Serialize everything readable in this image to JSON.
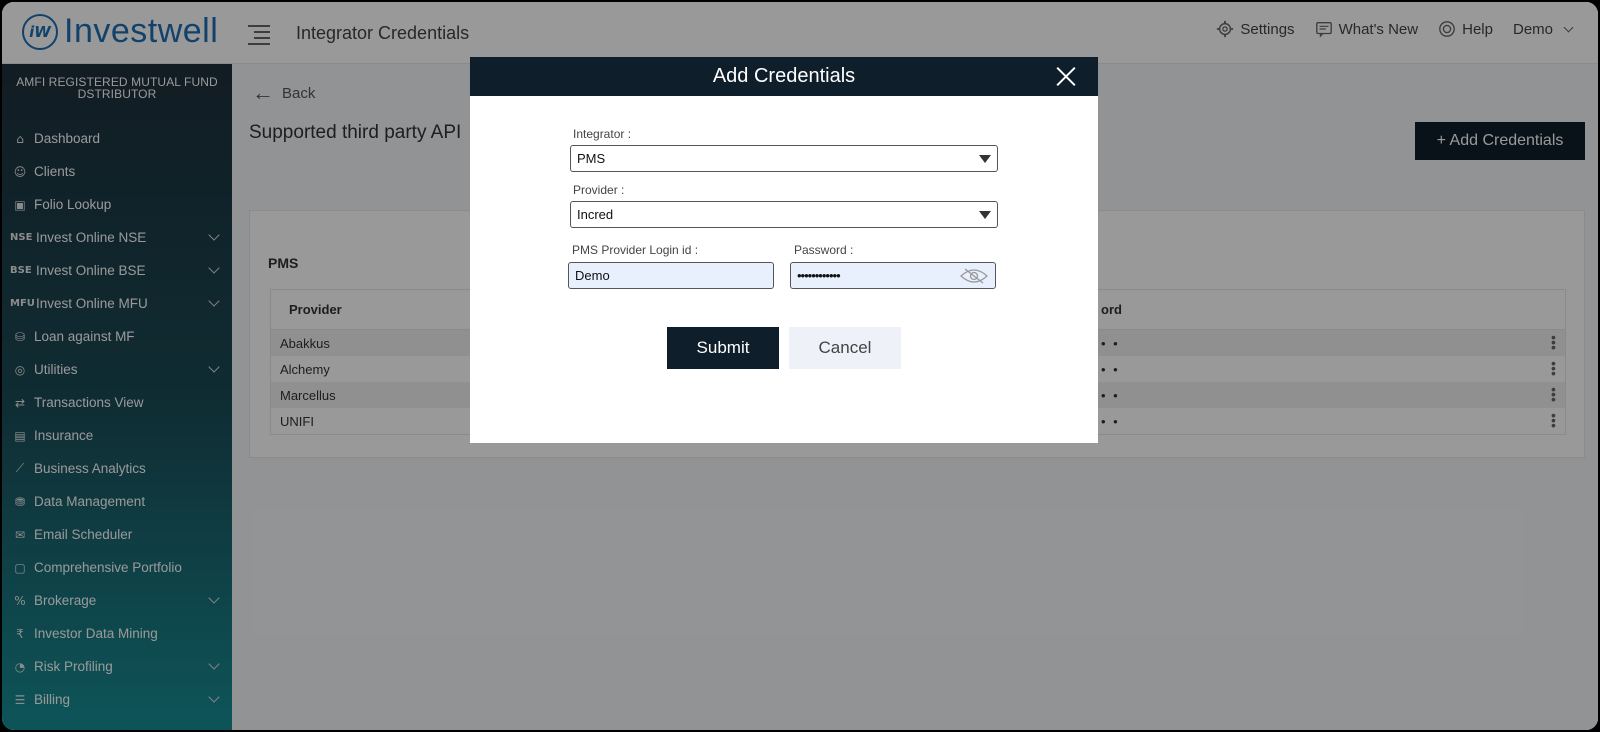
{
  "app": {
    "logo_text": "Investwell",
    "logo_mark": "iW"
  },
  "header": {
    "page_title": "Integrator Credentials",
    "settings": "Settings",
    "whats_new": "What's New",
    "help": "Help",
    "user": "Demo"
  },
  "sidebar": {
    "amfi_line1": "AMFI REGISTERED MUTUAL FUND",
    "amfi_line2": "DSTRIBUTOR",
    "items": [
      {
        "label": "Dashboard",
        "icon": "home-icon",
        "glyph": "⌂",
        "expandable": false
      },
      {
        "label": "Clients",
        "icon": "users-icon",
        "glyph": "☺",
        "expandable": false
      },
      {
        "label": "Folio Lookup",
        "icon": "folio-icon",
        "glyph": "▣",
        "expandable": false
      },
      {
        "label": "Invest Online NSE",
        "icon": "nse-icon",
        "glyph": "NSE",
        "expandable": true
      },
      {
        "label": "Invest Online BSE",
        "icon": "bse-icon",
        "glyph": "BSE",
        "expandable": true
      },
      {
        "label": "Invest Online MFU",
        "icon": "mfu-icon",
        "glyph": "MFU",
        "expandable": true
      },
      {
        "label": "Loan against MF",
        "icon": "loan-icon",
        "glyph": "⛁",
        "expandable": false
      },
      {
        "label": "Utilities",
        "icon": "utilities-icon",
        "glyph": "◎",
        "expandable": true
      },
      {
        "label": "Transactions View",
        "icon": "transactions-icon",
        "glyph": "⇄",
        "expandable": false
      },
      {
        "label": "Insurance",
        "icon": "insurance-icon",
        "glyph": "▤",
        "expandable": false
      },
      {
        "label": "Business Analytics",
        "icon": "analytics-icon",
        "glyph": "⟋",
        "expandable": false
      },
      {
        "label": "Data Management",
        "icon": "data-icon",
        "glyph": "⛃",
        "expandable": false
      },
      {
        "label": "Email Scheduler",
        "icon": "email-icon",
        "glyph": "✉",
        "expandable": false
      },
      {
        "label": "Comprehensive Portfolio",
        "icon": "portfolio-icon",
        "glyph": "▢",
        "expandable": false
      },
      {
        "label": "Brokerage",
        "icon": "brokerage-icon",
        "glyph": "%",
        "expandable": true
      },
      {
        "label": "Investor Data Mining",
        "icon": "mining-icon",
        "glyph": "₹",
        "expandable": false
      },
      {
        "label": "Risk Profiling",
        "icon": "risk-icon",
        "glyph": "◔",
        "expandable": true
      },
      {
        "label": "Billing",
        "icon": "billing-icon",
        "glyph": "☰",
        "expandable": true
      }
    ]
  },
  "main": {
    "back_label": "Back",
    "section_title": "Supported third party API",
    "add_button": "+ Add Credentials",
    "card_title": "PMS",
    "table": {
      "headers": [
        "Provider",
        "ord"
      ],
      "rows": [
        {
          "provider": "Abakkus",
          "password": "• •"
        },
        {
          "provider": "Alchemy",
          "password": "• •"
        },
        {
          "provider": "Marcellus",
          "password": "• •"
        },
        {
          "provider": "UNIFI",
          "password": "• •"
        }
      ]
    }
  },
  "modal": {
    "title": "Add Credentials",
    "integrator_label": "Integrator :",
    "integrator_value": "PMS",
    "provider_label": "Provider :",
    "provider_value": "Incred",
    "login_label": "PMS Provider Login id :",
    "login_value": "Demo",
    "password_label": "Password :",
    "password_value": "••••••••••••",
    "submit": "Submit",
    "cancel": "Cancel"
  },
  "colors": {
    "brand": "#1f6fb5",
    "navy": "#0f1e2b",
    "sidebar_top": "#1e2f3b",
    "sidebar_bottom": "#178e95",
    "input_fill": "#e8f0fe"
  }
}
